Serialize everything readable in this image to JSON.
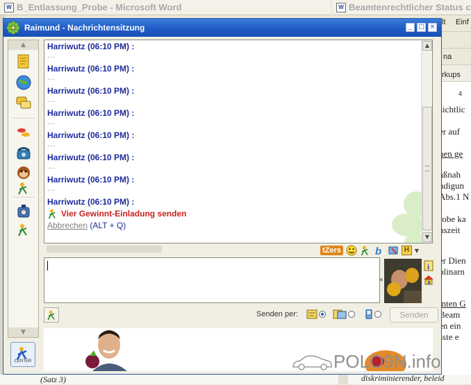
{
  "background": {
    "left_title": "B_Entlassung_Probe - Microsoft Word",
    "right_title": "Beamtenrechtlicher Status c",
    "word_icon": "W",
    "right_toolbar_texts": [
      "lt",
      "Einf",
      "na",
      "rkups",
      "4"
    ],
    "right_fragments": [
      {
        "text": "sichtlic",
        "ul": false
      },
      {
        "text": "er auf",
        "ul": false
      },
      {
        "text": "nen ge",
        "ul": true
      },
      {
        "text": "aßnah",
        "ul": false
      },
      {
        "text": "ndigun",
        "ul": false
      },
      {
        "text": "Abs.1 N",
        "ul": false
      },
      {
        "text": "robe ka",
        "ul": false
      },
      {
        "text": "nszeit",
        "ul": false
      },
      {
        "text": "er Dien",
        "ul": false
      },
      {
        "text": "plinarn",
        "ul": false
      },
      {
        "text": "mten G",
        "ul": true
      },
      {
        "text": "Beam",
        "ul": false
      },
      {
        "text": "en ein",
        "ul": false
      },
      {
        "text": "sste e",
        "ul": false
      }
    ],
    "bottom_left": "(Satz 3)",
    "bottom_right": "diskriminierender, beleid"
  },
  "window": {
    "title": "Raimund - Nachrichtensitzung",
    "btn_min": "_",
    "btn_max": "□",
    "btn_close": "×"
  },
  "history": {
    "messages": [
      {
        "name": "Harriwutz (06:10 PM) :",
        "body": "..."
      },
      {
        "name": "Harriwutz (06:10 PM) :",
        "body": "..."
      },
      {
        "name": "Harriwutz (06:10 PM) :",
        "body": "..."
      },
      {
        "name": "Harriwutz (06:10 PM) :",
        "body": "..."
      },
      {
        "name": "Harriwutz (06:10 PM) :",
        "body": "..."
      },
      {
        "name": "Harriwutz (06:10 PM) :",
        "body": "..."
      },
      {
        "name": "Harriwutz (06:10 PM) :",
        "body": "..."
      },
      {
        "name": "Harriwutz (06:10 PM) :",
        "body": ""
      }
    ],
    "invite_text": "Vier Gewinnt-Einladung senden",
    "cancel_link": "Abbrechen",
    "cancel_shortcut": "(ALT + Q)"
  },
  "toolbar": {
    "tzers_label": "tZers",
    "h_label": "H"
  },
  "send": {
    "via_label": "Senden per:",
    "button_label": "Senden",
    "selected_option": 0
  },
  "watermark": "POLO9N.info",
  "center_label": "CENTER",
  "colors": {
    "name_blue": "#1e2a9c",
    "invite_red": "#c8211e",
    "title_blue": "#1e5bc6",
    "icq_green": "#7cc242"
  }
}
